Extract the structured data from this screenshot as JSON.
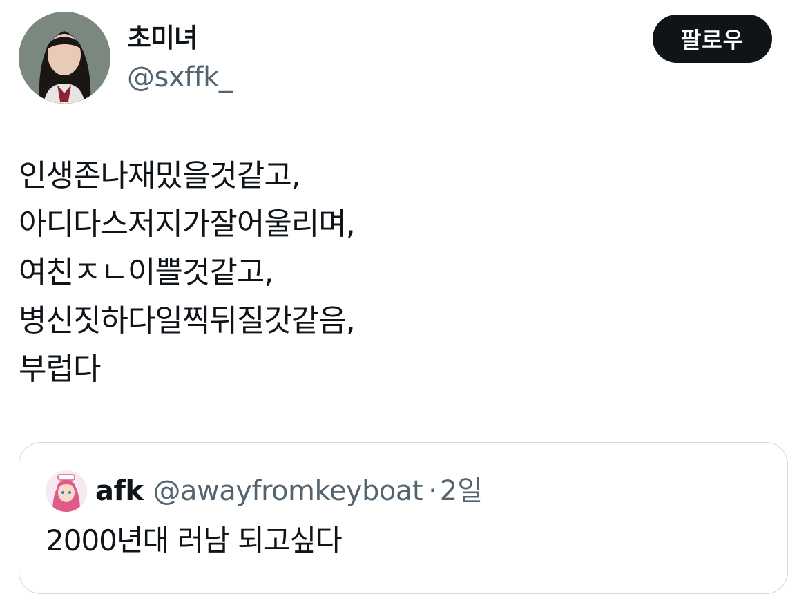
{
  "author": {
    "display_name": "초미녀",
    "handle": "@sxffk_"
  },
  "follow_button_label": "팔로우",
  "tweet": {
    "lines": [
      "인생존나재밌을것같고,",
      "아디다스저지가잘어울리며,",
      "여친ㅈㄴ이쁠것같고,",
      "병신짓하다일찍뒤질갓같음,",
      "부럽다"
    ]
  },
  "quoted_tweet": {
    "display_name": "afk",
    "handle": "@awayfromkeyboat",
    "separator": "·",
    "time": "2일",
    "text": "2000년대 러남 되고싶다"
  },
  "colors": {
    "text_primary": "#0f1419",
    "text_secondary": "#536471",
    "border": "#cfd9de",
    "button_bg": "#0f1419"
  },
  "icons": {
    "author_avatar": "profile-photo",
    "quoted_avatar": "anime-character-avatar"
  }
}
